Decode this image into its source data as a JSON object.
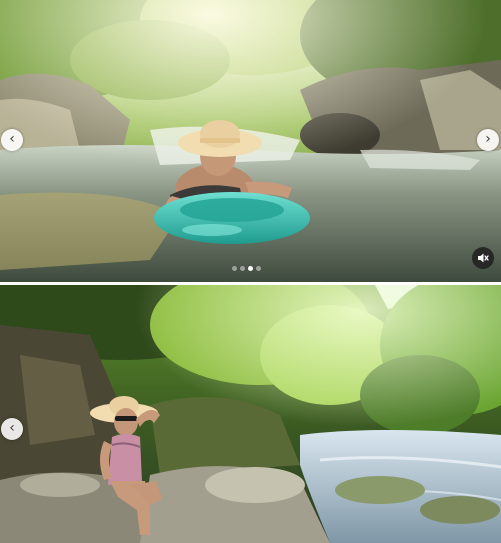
{
  "feed": {
    "posts": [
      {
        "media": {
          "icon": "photo-river-tube",
          "kind": "video"
        },
        "carousel": {
          "slide_count": 4,
          "active_slide": 3
        },
        "controls": {
          "prev_icon": "chevron-left-icon",
          "next_icon": "chevron-right-icon",
          "mute_icon": "speaker-muted-icon",
          "prev_glyph": "‹",
          "next_glyph": "›"
        }
      },
      {
        "media": {
          "icon": "photo-forest-rock",
          "kind": "image"
        },
        "controls": {
          "prev_icon": "chevron-left-icon",
          "prev_glyph": "‹"
        }
      }
    ]
  },
  "colors": {
    "nav_button_bg": "#ffffff",
    "mute_button_bg": "#1e1e1e",
    "tube_teal": "#2fc0b0",
    "hat_straw": "#f2ddb0",
    "foliage": "#4f8a2a",
    "water": "#6e7f70"
  }
}
